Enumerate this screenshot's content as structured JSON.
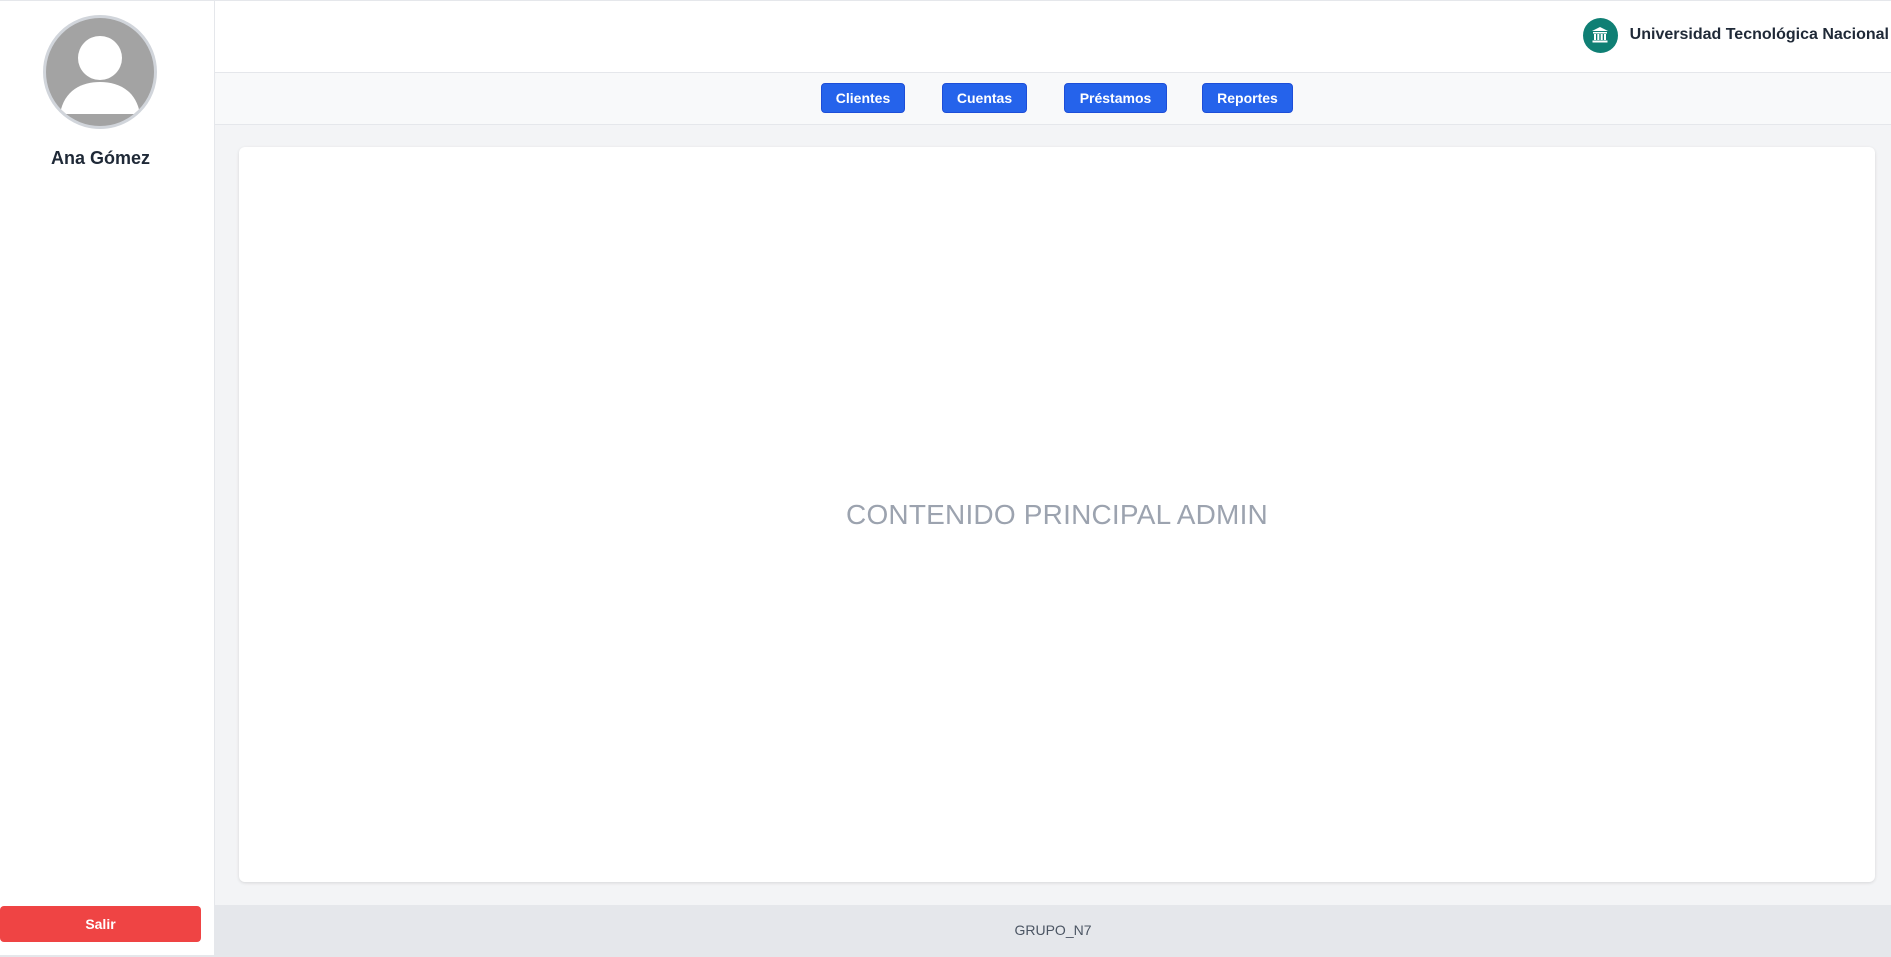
{
  "sidebar": {
    "user_name": "Ana Gómez",
    "avatar_icon": "user-avatar-icon",
    "logout_label": "Salir"
  },
  "header": {
    "brand_name": "Universidad Tecnológica Nacional",
    "brand_icon": "institution-icon"
  },
  "nav": {
    "items": [
      {
        "label": "Clientes"
      },
      {
        "label": "Cuentas"
      },
      {
        "label": "Préstamos"
      },
      {
        "label": "Reportes"
      }
    ]
  },
  "main": {
    "content_text": "CONTENIDO PRINCIPAL ADMIN"
  },
  "footer": {
    "text": "GRUPO_N7"
  },
  "colors": {
    "primary": "#2563eb",
    "danger": "#ef4444",
    "brand": "#0f7f74",
    "background": "#f3f4f6"
  }
}
